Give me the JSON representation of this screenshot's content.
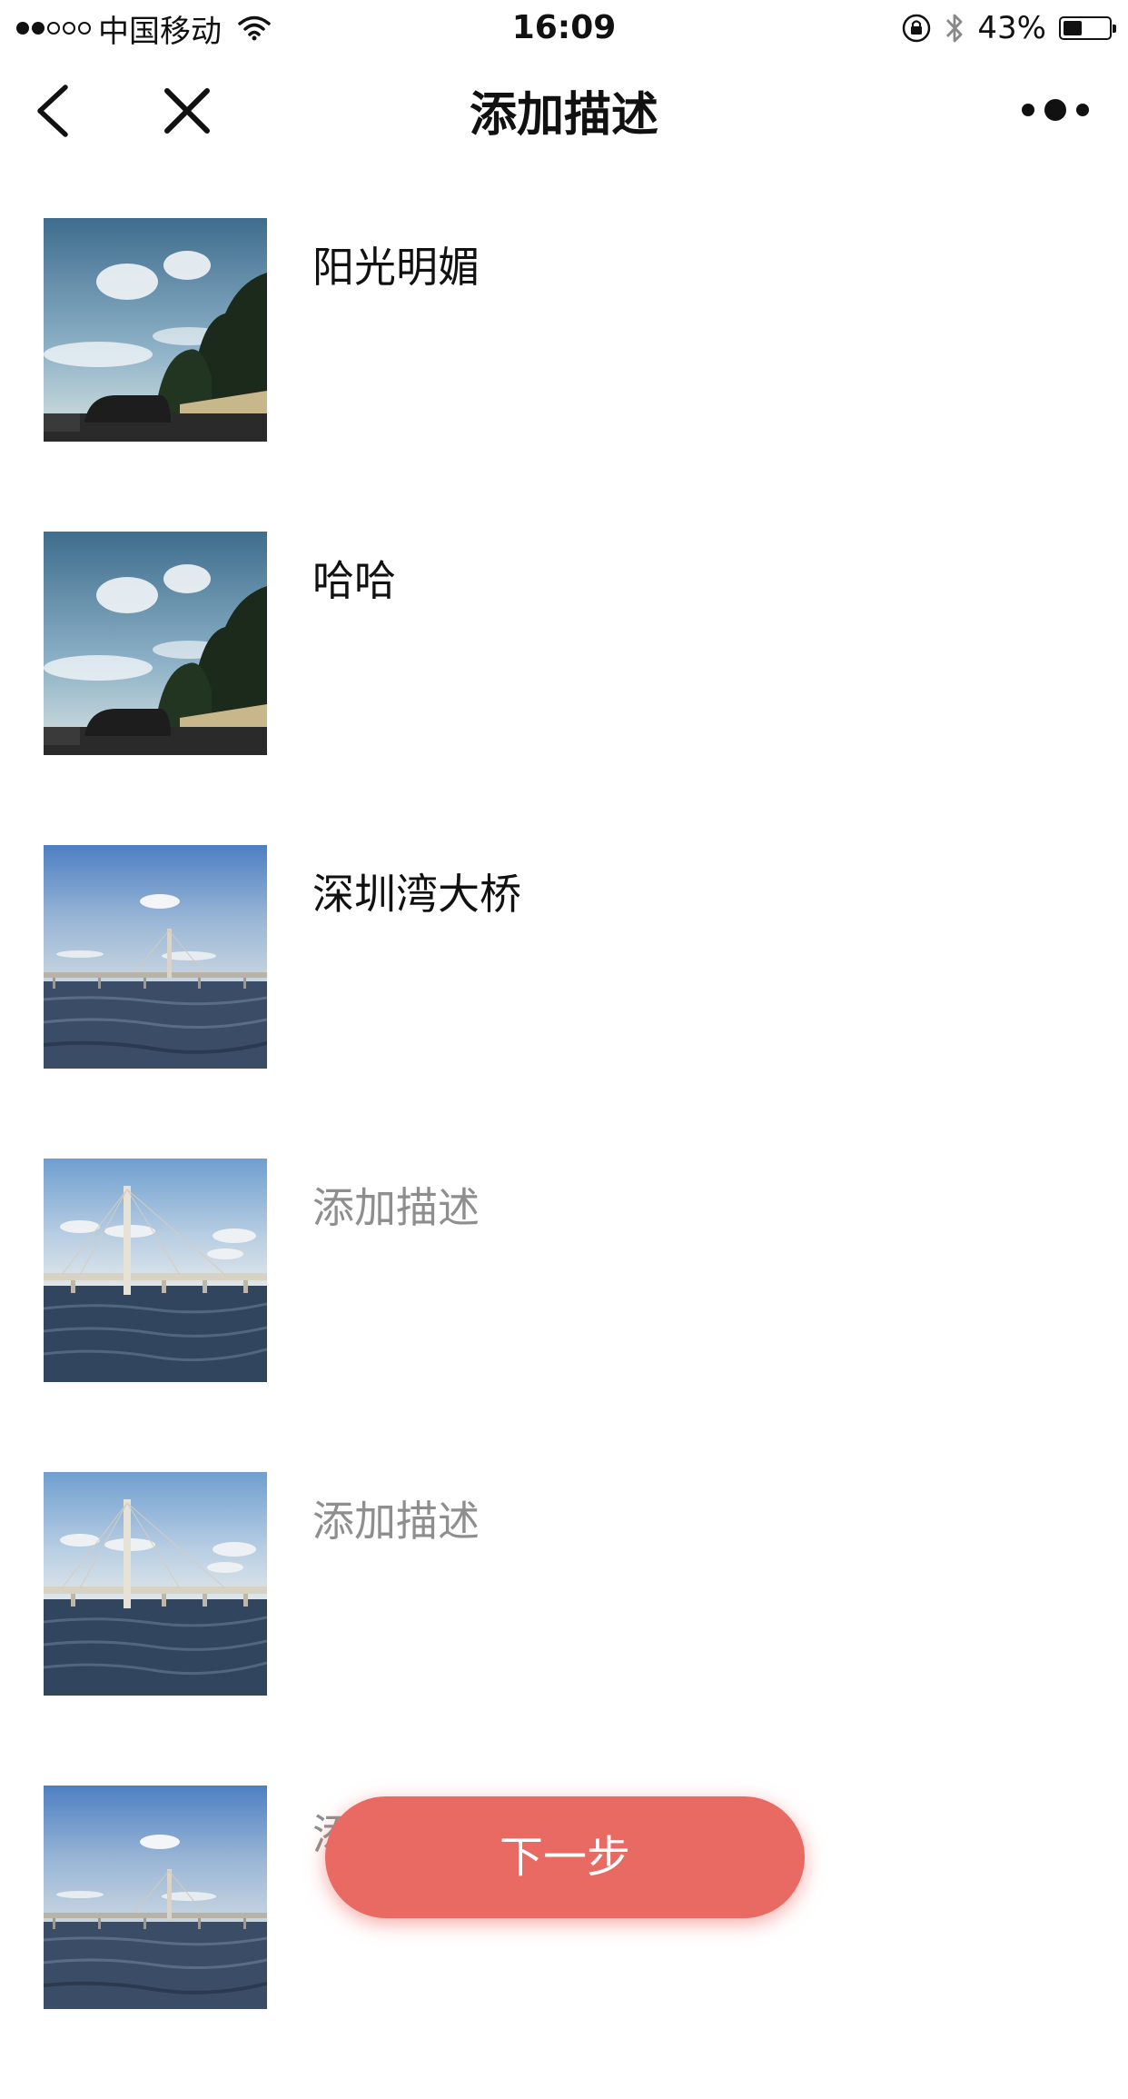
{
  "status_bar": {
    "carrier": "中国移动",
    "time": "16:09",
    "battery_percent": "43%",
    "battery_level": 0.43,
    "signal_bars_filled": 2,
    "signal_bars_total": 5,
    "icons": [
      "wifi-icon",
      "orientation-lock-icon",
      "bluetooth-icon",
      "battery-icon"
    ]
  },
  "navbar": {
    "title": "添加描述",
    "back_icon": "chevron-left-icon",
    "close_icon": "close-icon",
    "more_icon": "more-dots-icon"
  },
  "photos": [
    {
      "description": "阳光明媚",
      "is_placeholder": false,
      "scene": "sky-trees"
    },
    {
      "description": "哈哈",
      "is_placeholder": false,
      "scene": "sky-trees"
    },
    {
      "description": "深圳湾大桥",
      "is_placeholder": false,
      "scene": "bridge-far"
    },
    {
      "description": "添加描述",
      "is_placeholder": true,
      "scene": "bridge-near"
    },
    {
      "description": "添加描述",
      "is_placeholder": true,
      "scene": "bridge-near"
    },
    {
      "description": "添加描述",
      "is_placeholder": true,
      "scene": "bridge-far"
    }
  ],
  "next_button": {
    "label": "下一步",
    "color": "#e96a63"
  }
}
